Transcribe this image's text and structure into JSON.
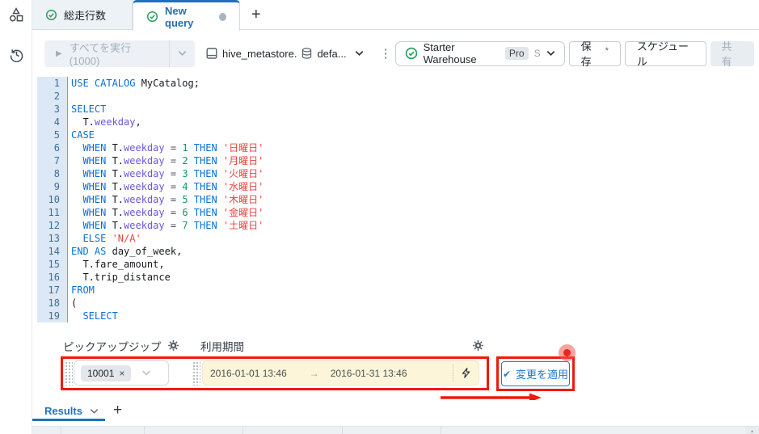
{
  "colors": {
    "accent": "#2272b4",
    "annotation_red": "#ee1a0c",
    "keyword_blue": "#0a70d6",
    "identifier_purple": "#6c57d5",
    "number_green": "#12985c",
    "string_red": "#e8453c",
    "success_green": "#2c9e5f",
    "date_field_bg": "#fcf5da",
    "gutter_bg": "#dce8f6"
  },
  "icons": {
    "run": "▶",
    "kebab": "⋮",
    "close": "×",
    "range_arrow": "→",
    "check": "✔",
    "plus": "+",
    "sort": "▴"
  },
  "tabs": {
    "tab1": {
      "label": "総走行数"
    },
    "tab2": {
      "label": "New query"
    }
  },
  "toolbar": {
    "run_label": "すべてを実行 (1000)",
    "catalog": "hive_metastore.",
    "schema": "defa...",
    "warehouse": {
      "name": "Starter Warehouse",
      "tier": "Pro",
      "size": "S"
    },
    "save_label": "保 存",
    "save_dirty_mark": "*",
    "schedule_label": "スケジュール",
    "share_label": "共 有"
  },
  "editor": {
    "lines": [
      {
        "num": 1,
        "tokens": [
          [
            "kw",
            "USE CATALOG"
          ],
          [
            "pl",
            " MyCatalog;"
          ]
        ]
      },
      {
        "num": 2,
        "tokens": []
      },
      {
        "num": 3,
        "tokens": [
          [
            "kw",
            "SELECT"
          ]
        ]
      },
      {
        "num": 4,
        "tokens": [
          [
            "pl",
            "  T."
          ],
          [
            "id",
            "weekday"
          ],
          [
            "pl",
            ","
          ]
        ]
      },
      {
        "num": 5,
        "tokens": [
          [
            "kw",
            "CASE"
          ]
        ]
      },
      {
        "num": 6,
        "tokens": [
          [
            "kw",
            "  WHEN"
          ],
          [
            "pl",
            " T."
          ],
          [
            "id",
            "weekday"
          ],
          [
            "op",
            " = "
          ],
          [
            "num",
            "1"
          ],
          [
            "kw",
            " THEN"
          ],
          [
            "str",
            " '日曜日'"
          ]
        ]
      },
      {
        "num": 7,
        "tokens": [
          [
            "kw",
            "  WHEN"
          ],
          [
            "pl",
            " T."
          ],
          [
            "id",
            "weekday"
          ],
          [
            "op",
            " = "
          ],
          [
            "num",
            "2"
          ],
          [
            "kw",
            " THEN"
          ],
          [
            "str",
            " '月曜日'"
          ]
        ]
      },
      {
        "num": 8,
        "tokens": [
          [
            "kw",
            "  WHEN"
          ],
          [
            "pl",
            " T."
          ],
          [
            "id",
            "weekday"
          ],
          [
            "op",
            " = "
          ],
          [
            "num",
            "3"
          ],
          [
            "kw",
            " THEN"
          ],
          [
            "str",
            " '火曜日'"
          ]
        ]
      },
      {
        "num": 9,
        "tokens": [
          [
            "kw",
            "  WHEN"
          ],
          [
            "pl",
            " T."
          ],
          [
            "id",
            "weekday"
          ],
          [
            "op",
            " = "
          ],
          [
            "num",
            "4"
          ],
          [
            "kw",
            " THEN"
          ],
          [
            "str",
            " '水曜日'"
          ]
        ]
      },
      {
        "num": 10,
        "tokens": [
          [
            "kw",
            "  WHEN"
          ],
          [
            "pl",
            " T."
          ],
          [
            "id",
            "weekday"
          ],
          [
            "op",
            " = "
          ],
          [
            "num",
            "5"
          ],
          [
            "kw",
            " THEN"
          ],
          [
            "str",
            " '木曜日'"
          ]
        ]
      },
      {
        "num": 11,
        "tokens": [
          [
            "kw",
            "  WHEN"
          ],
          [
            "pl",
            " T."
          ],
          [
            "id",
            "weekday"
          ],
          [
            "op",
            " = "
          ],
          [
            "num",
            "6"
          ],
          [
            "kw",
            " THEN"
          ],
          [
            "str",
            " '金曜日'"
          ]
        ]
      },
      {
        "num": 12,
        "tokens": [
          [
            "kw",
            "  WHEN"
          ],
          [
            "pl",
            " T."
          ],
          [
            "id",
            "weekday"
          ],
          [
            "op",
            " = "
          ],
          [
            "num",
            "7"
          ],
          [
            "kw",
            " THEN"
          ],
          [
            "str",
            " '土曜日'"
          ]
        ]
      },
      {
        "num": 13,
        "tokens": [
          [
            "kw",
            "  ELSE"
          ],
          [
            "str",
            " 'N/A'"
          ]
        ]
      },
      {
        "num": 14,
        "tokens": [
          [
            "kw",
            "END"
          ],
          [
            "pl",
            " "
          ],
          [
            "kw",
            "AS"
          ],
          [
            "pl",
            " day_of_week,"
          ]
        ]
      },
      {
        "num": 15,
        "tokens": [
          [
            "pl",
            "  T.fare_amount,"
          ]
        ]
      },
      {
        "num": 16,
        "tokens": [
          [
            "pl",
            "  T.trip_distance"
          ]
        ]
      },
      {
        "num": 17,
        "tokens": [
          [
            "kw",
            "FROM"
          ]
        ]
      },
      {
        "num": 18,
        "tokens": [
          [
            "pl",
            "("
          ]
        ]
      },
      {
        "num": 19,
        "tokens": [
          [
            "kw",
            "  SELECT"
          ]
        ]
      }
    ]
  },
  "params": {
    "pickup_zip": {
      "label": "ピックアップジップ",
      "chip_value": "10001"
    },
    "period": {
      "label": "利用期間",
      "start": "2016-01-01 13:46",
      "end": "2016-01-31 13:46"
    },
    "apply_label": "変更を適用"
  },
  "results": {
    "tab_label": "Results"
  }
}
